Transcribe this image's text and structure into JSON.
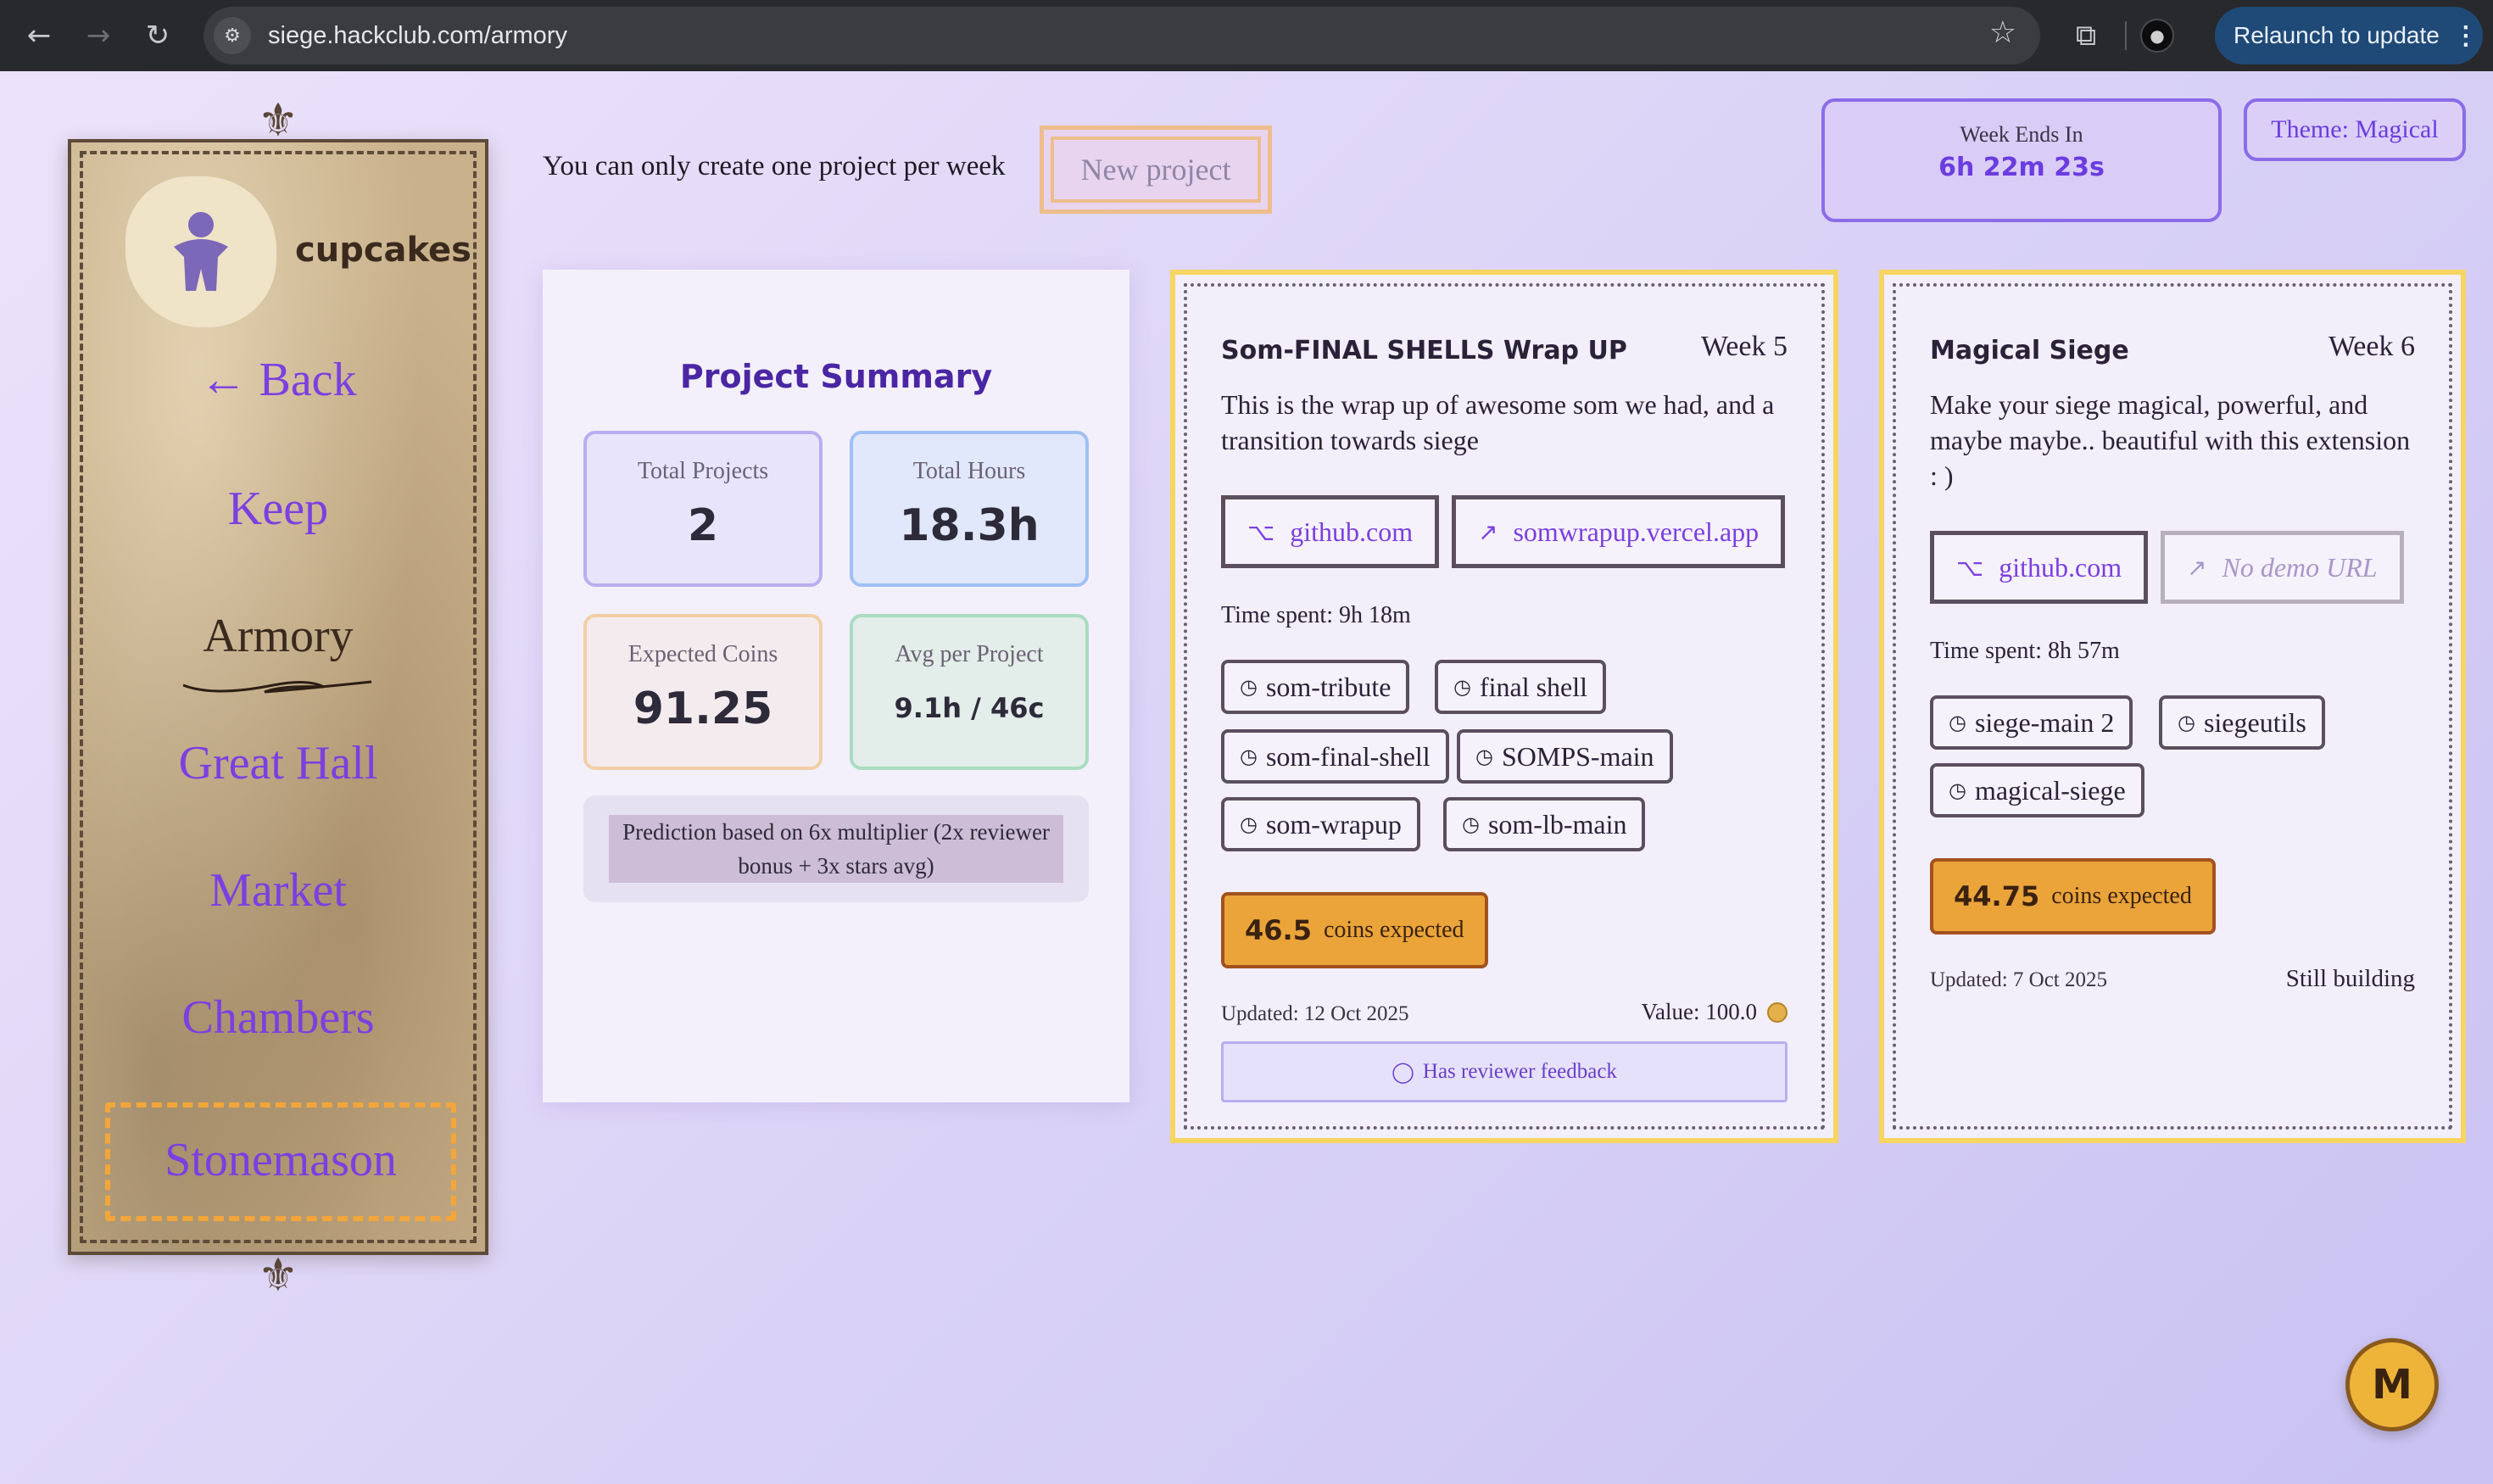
{
  "browser": {
    "url": "siege.hackclub.com/armory",
    "relaunch_label": "Relaunch to update",
    "icons": [
      "back-icon",
      "forward-icon",
      "reload-icon",
      "site-settings-icon",
      "star-icon",
      "extensions-icon",
      "profile-icon",
      "more-icon"
    ]
  },
  "sidebar": {
    "username": "cupcakes",
    "back": "← Back",
    "items": [
      {
        "label": "Keep"
      },
      {
        "label": "Armory"
      },
      {
        "label": "Great Hall"
      },
      {
        "label": "Market"
      },
      {
        "label": "Chambers"
      },
      {
        "label": "Stonemason"
      }
    ],
    "active": "Armory"
  },
  "header": {
    "limit_text": "You can only create one project per week",
    "new_project": "New project",
    "week_ends_label": "Week Ends In",
    "week_ends_value": "6h 22m 23s",
    "theme": "Theme: Magical"
  },
  "summary": {
    "title": "Project Summary",
    "stats": [
      {
        "label": "Total Projects",
        "value": "2"
      },
      {
        "label": "Total Hours",
        "value": "18.3h"
      },
      {
        "label": "Expected Coins",
        "value": "91.25"
      },
      {
        "label": "Avg per Project",
        "value": "9.1h / 46c"
      }
    ],
    "prediction": "Prediction based on 6x multiplier (2x reviewer bonus + 3x stars avg)"
  },
  "projects": [
    {
      "title": "Som-FINAL SHELLS Wrap UP",
      "week": "Week 5",
      "description_lines": [
        "This is the wrap up of awesome som we had, and a",
        "transition towards siege"
      ],
      "repo": "github.com",
      "demo": "somwrapup.vercel.app",
      "time_spent": "Time spent: 9h 18m",
      "tags": [
        "som-tribute",
        "final shell",
        "som-final-shell",
        "SOMPS-main",
        "som-wrapup",
        "som-lb-main"
      ],
      "coins": "46.5",
      "coins_label": "coins expected",
      "updated": "Updated: 12 Oct 2025",
      "value": "Value: 100.0",
      "feedback": "Has reviewer feedback"
    },
    {
      "title": "Magical Siege",
      "week": "Week 6",
      "description_lines": [
        "Make your siege magical, powerful, and",
        "maybe maybe.. beautiful with this extension",
        ": )"
      ],
      "repo": "github.com",
      "demo": "No demo URL",
      "time_spent": "Time spent: 8h 57m",
      "tags": [
        "siege-main 2",
        "siegeutils",
        "magical-siege"
      ],
      "coins": "44.75",
      "coins_label": "coins expected",
      "updated": "Updated: 7 Oct 2025",
      "status": "Still building"
    }
  ],
  "badge": "M",
  "colors": {
    "accent": "#7c3fe0",
    "card_border": "#f6d561",
    "coins": "#eaa43a"
  }
}
